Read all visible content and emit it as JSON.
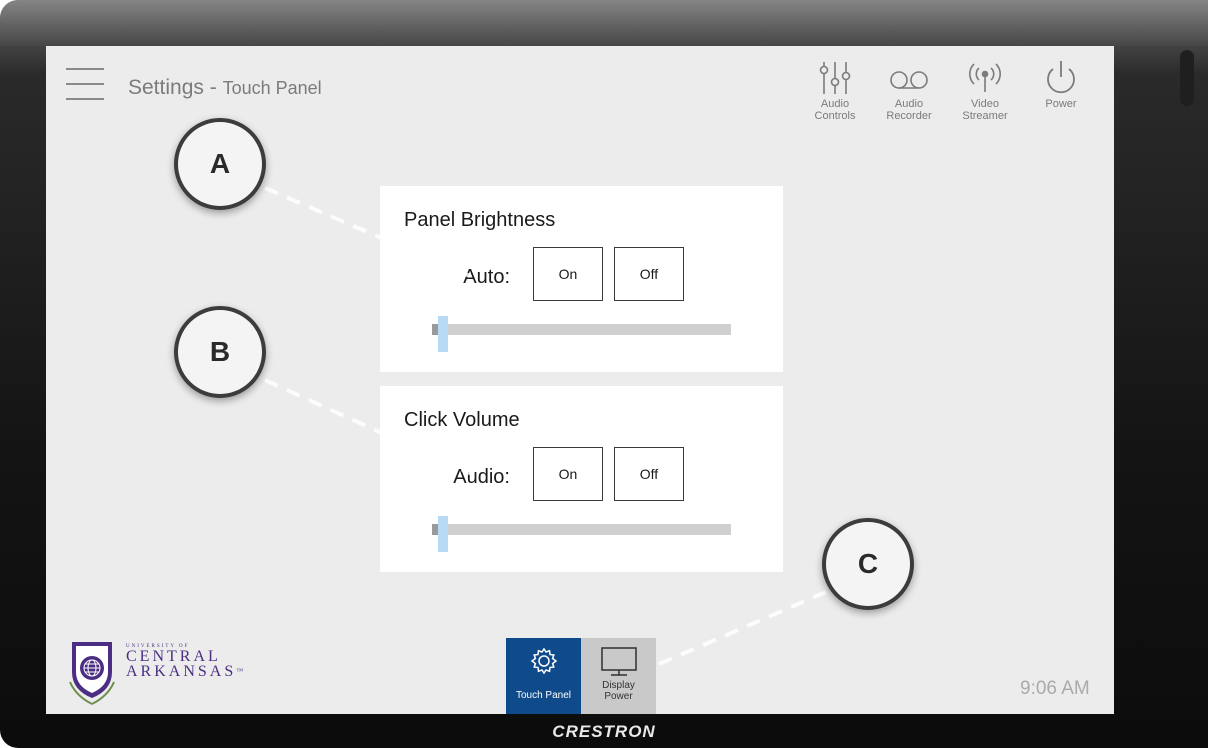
{
  "header": {
    "title": "Settings",
    "separator": " - ",
    "subtitle": "Touch Panel",
    "buttons": [
      {
        "icon": "audio-sliders-icon",
        "line1": "Audio",
        "line2": "Controls"
      },
      {
        "icon": "voicemail-recorder-icon",
        "line1": "Audio",
        "line2": "Recorder"
      },
      {
        "icon": "broadcast-icon",
        "line1": "Video",
        "line2": "Streamer"
      },
      {
        "icon": "power-icon",
        "line1": "Power",
        "line2": ""
      }
    ]
  },
  "cards": {
    "brightness": {
      "title": "Panel Brightness",
      "label": "Auto:",
      "on": "On",
      "off": "Off",
      "level": 0.02
    },
    "volume": {
      "title": "Click Volume",
      "label": "Audio:",
      "on": "On",
      "off": "Off",
      "level": 0.02
    }
  },
  "callouts": {
    "a": "A",
    "b": "B",
    "c": "C"
  },
  "logo": {
    "line1": "UNIVERSITY OF",
    "line2": "CENTRAL",
    "line3": "ARKANSAS",
    "tm": "™"
  },
  "nav": {
    "touch_panel": "Touch Panel",
    "display_line1": "Display",
    "display_line2": "Power"
  },
  "status": {
    "time": "9:06 AM"
  },
  "brand": "CRESTRON",
  "colors": {
    "accent": "#0f4b8a",
    "nav_inactive": "#c9c9c9",
    "slider_thumb": "#b8daf4",
    "logo": "#4b2e83"
  }
}
